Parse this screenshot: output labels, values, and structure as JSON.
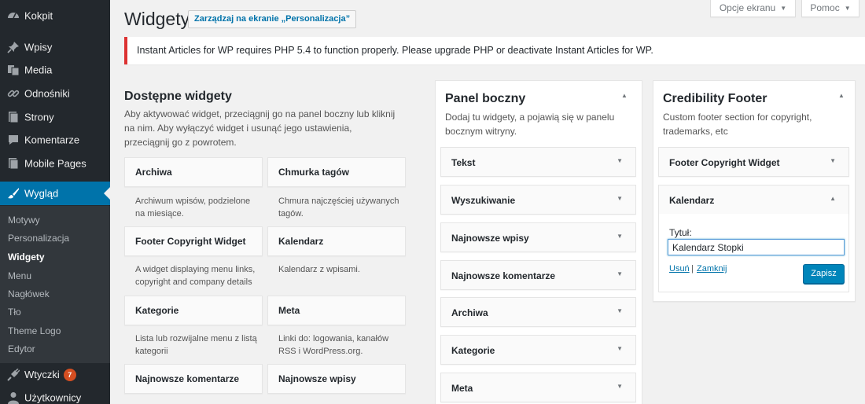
{
  "sidebar": {
    "items": [
      {
        "label": "Kokpit",
        "icon": "dashboard-icon"
      },
      {
        "label": "Wpisy",
        "icon": "pin-icon"
      },
      {
        "label": "Media",
        "icon": "media-icon"
      },
      {
        "label": "Odnośniki",
        "icon": "link-icon"
      },
      {
        "label": "Strony",
        "icon": "page-icon"
      },
      {
        "label": "Komentarze",
        "icon": "comment-icon"
      },
      {
        "label": "Mobile Pages",
        "icon": "page-icon"
      },
      {
        "label": "Wygląd",
        "icon": "brush-icon",
        "active": true
      },
      {
        "label": "Wtyczki",
        "icon": "plugin-icon",
        "badge": "7"
      },
      {
        "label": "Użytkownicy",
        "icon": "users-icon"
      }
    ],
    "submenu": [
      "Motywy",
      "Personalizacja",
      "Widgety",
      "Menu",
      "Nagłówek",
      "Tło",
      "Theme Logo",
      "Edytor"
    ],
    "submenu_current": "Widgety"
  },
  "header": {
    "title": "Widgety",
    "manage_button": "Zarządzaj na ekranie „Personalizacja”",
    "screen_options": "Opcje ekranu",
    "help": "Pomoc"
  },
  "notice": "Instant Articles for WP requires PHP 5.4 to function properly. Please upgrade PHP or deactivate Instant Articles for WP.",
  "available": {
    "title": "Dostępne widgety",
    "description": "Aby aktywować widget, przeciągnij go na panel boczny lub kliknij na nim. Aby wyłączyć widget i usunąć jego ustawienia, przeciągnij go z powrotem.",
    "widgets": [
      {
        "title": "Archiwa",
        "desc": "Archiwum wpisów, podzielone na miesiące."
      },
      {
        "title": "Chmurka tagów",
        "desc": "Chmura najczęściej używanych tagów."
      },
      {
        "title": "Footer Copyright Widget",
        "desc": "A widget displaying menu links, copyright and company details"
      },
      {
        "title": "Kalendarz",
        "desc": "Kalendarz z wpisami."
      },
      {
        "title": "Kategorie",
        "desc": "Lista lub rozwijalne menu z listą kategorii"
      },
      {
        "title": "Meta",
        "desc": "Linki do: logowania, kanałów RSS i WordPress.org."
      },
      {
        "title": "Najnowsze komentarze",
        "desc": ""
      },
      {
        "title": "Najnowsze wpisy",
        "desc": ""
      }
    ]
  },
  "panel_boczny": {
    "title": "Panel boczny",
    "description": "Dodaj tu widgety, a pojawią się w panelu bocznym witryny.",
    "widgets": [
      "Tekst",
      "Wyszukiwanie",
      "Najnowsze wpisy",
      "Najnowsze komentarze",
      "Archiwa",
      "Kategorie",
      "Meta"
    ]
  },
  "credibility_footer": {
    "title": "Credibility Footer",
    "description": "Custom footer section for copyright, trademarks, etc",
    "widgets": [
      "Footer Copyright Widget",
      "Kalendarz"
    ],
    "expanded": {
      "title_label": "Tytuł:",
      "title_value": "Kalendarz Stopki",
      "delete_link": "Usuń",
      "separator": "|",
      "close_link": "Zamknij",
      "save_button": "Zapisz"
    }
  },
  "colors": {
    "accent": "#0073aa",
    "sidebar": "#23282d",
    "notice_error": "#dc3232",
    "badge": "#d54e21"
  }
}
